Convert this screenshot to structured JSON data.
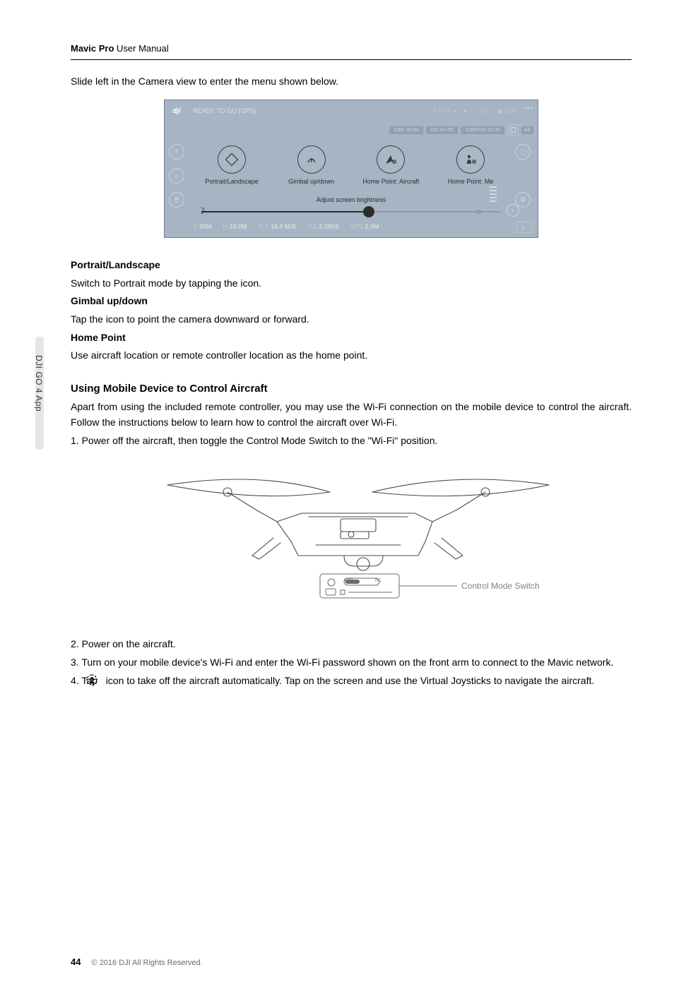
{
  "header": {
    "product": "Mavic Pro",
    "doc": "User Manual"
  },
  "intro": "Slide left in the Camera view to enter the menu shown below.",
  "sideTab": "DJI GO 4 App",
  "shot": {
    "status": "READY TO GO (GPS)",
    "badges": "P-GPS   ▾...  ●  ⬚... HD...  ▣ 61%",
    "pills": {
      "a": "1080  30 fps",
      "b": "ISO AUTO",
      "c": "1080P/24 29:30"
    },
    "ae": "AE",
    "icons": [
      "Portrait/Landscape",
      "Gimbal up/down",
      "Home Point: Aircraft",
      "Home Point: Me"
    ],
    "brightness": "Adjust screen brightness",
    "tel": {
      "d_k": "D",
      "d_v": "30M",
      "h_k": "H",
      "h_v": "10.0M",
      "hs_k": "H.S",
      "hs_v": "10.0 M/S",
      "vs_k": "V.S",
      "vs_v": "2.0M/S",
      "vps_k": "VPS",
      "vps_v": "2.0M"
    }
  },
  "body": {
    "pl_title": "Portrait/Landscape",
    "pl_text": "Switch to Portrait mode by tapping the icon.",
    "g_title": "Gimbal up/down",
    "g_text": "Tap the icon to point the camera downward or forward.",
    "hp_title": "Home Point",
    "hp_text": "Use aircraft location or remote controller location as the home point.",
    "wifi_title": "Using Mobile Device to Control Aircraft",
    "wifi_p": "Apart from using the included remote controller, you may use the Wi-Fi connection on the mobile device to control the aircraft. Follow the instructions below to learn how to control the aircraft over Wi-Fi.",
    "step1": "1.  Power off the aircraft, then toggle the Control Mode Switch to the \"Wi-Fi\" position.",
    "callout": "Control Mode Switch",
    "step2": "2.  Power on the aircraft.",
    "step3": "3.  Turn on your mobile device's Wi-Fi and enter the Wi-Fi password shown on the front arm to connect to the Mavic network.",
    "step4a": "4.  Tap ",
    "step4b": " icon to take off the aircraft automatically. Tap on the screen and use the Virtual Joysticks to navigate the aircraft."
  },
  "footer": {
    "page": "44",
    "copy": "© 2016 DJI All Rights Reserved."
  }
}
